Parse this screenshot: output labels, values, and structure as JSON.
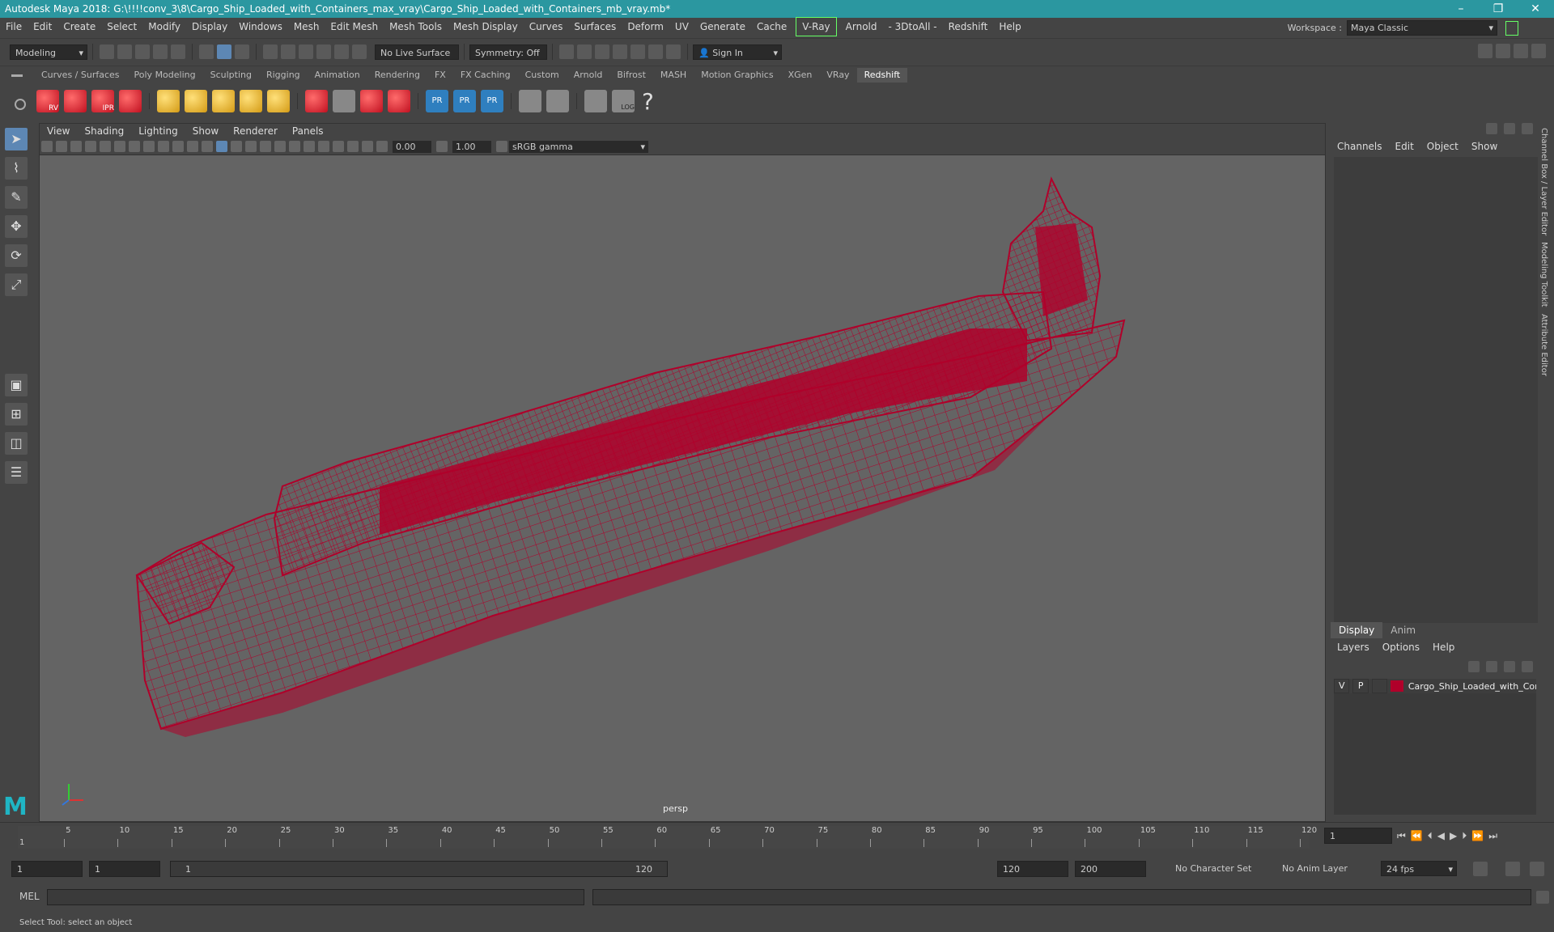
{
  "window": {
    "title": "Autodesk Maya 2018: G:\\!!!!conv_3\\8\\Cargo_Ship_Loaded_with_Containers_max_vray\\Cargo_Ship_Loaded_with_Containers_mb_vray.mb*",
    "min_glyph": "–",
    "max_glyph": "❐",
    "close_glyph": "✕"
  },
  "menubar": {
    "items": [
      "File",
      "Edit",
      "Create",
      "Select",
      "Modify",
      "Display",
      "Windows",
      "Mesh",
      "Edit Mesh",
      "Mesh Tools",
      "Mesh Display",
      "Curves",
      "Surfaces",
      "Deform",
      "UV",
      "Generate",
      "Cache"
    ],
    "vray": "V-Ray",
    "items2": [
      "Arnold",
      "- 3DtoAll -",
      "Redshift",
      "Help"
    ]
  },
  "workspace": {
    "label": "Workspace :",
    "value": "Maya Classic"
  },
  "statusline": {
    "mode": "Modeling",
    "live_surface": "No Live Surface",
    "symmetry": "Symmetry: Off",
    "sign_in": "Sign In"
  },
  "shelf": {
    "tabs": [
      "Curves / Surfaces",
      "Poly Modeling",
      "Sculpting",
      "Rigging",
      "Animation",
      "Rendering",
      "FX",
      "FX Caching",
      "Custom",
      "Arnold",
      "Bifrost",
      "MASH",
      "Motion Graphics",
      "XGen",
      "VRay",
      "Redshift"
    ],
    "active_tab": "Redshift",
    "rv_label": "RV",
    "ipr_label": "IPR",
    "pr_label": "PR",
    "log_label": "LOG",
    "help_glyph": "?"
  },
  "viewport": {
    "menus": [
      "View",
      "Shading",
      "Lighting",
      "Show",
      "Renderer",
      "Panels"
    ],
    "exposure": "0.00",
    "gamma_value": "1.00",
    "color_space": "sRGB gamma",
    "camera": "persp",
    "wire_color": "#b0002a"
  },
  "channelbox": {
    "menus": [
      "Channels",
      "Edit",
      "Object",
      "Show"
    ],
    "side_tabs": [
      "Channel Box / Layer Editor",
      "Modeling Toolkit",
      "Attribute Editor"
    ]
  },
  "layers": {
    "tabs": [
      "Display",
      "Anim"
    ],
    "menus": [
      "Layers",
      "Options",
      "Help"
    ],
    "row": {
      "v": "V",
      "p": "P",
      "name": "Cargo_Ship_Loaded_with_Con"
    }
  },
  "timeline": {
    "ticks": [
      "5",
      "10",
      "15",
      "20",
      "25",
      "30",
      "35",
      "40",
      "45",
      "50",
      "55",
      "60",
      "65",
      "70",
      "75",
      "80",
      "85",
      "90",
      "95",
      "100",
      "105",
      "110",
      "115",
      "120"
    ],
    "start_tick": "1",
    "current_frame": "1"
  },
  "range": {
    "start": "1",
    "start2": "1",
    "slider_start": "1",
    "slider_end": "120",
    "end": "120",
    "end2": "200",
    "character_set": "No Character Set",
    "anim_layer": "No Anim Layer",
    "fps": "24 fps"
  },
  "command": {
    "label": "MEL"
  },
  "help": {
    "text": "Select Tool: select an object"
  }
}
